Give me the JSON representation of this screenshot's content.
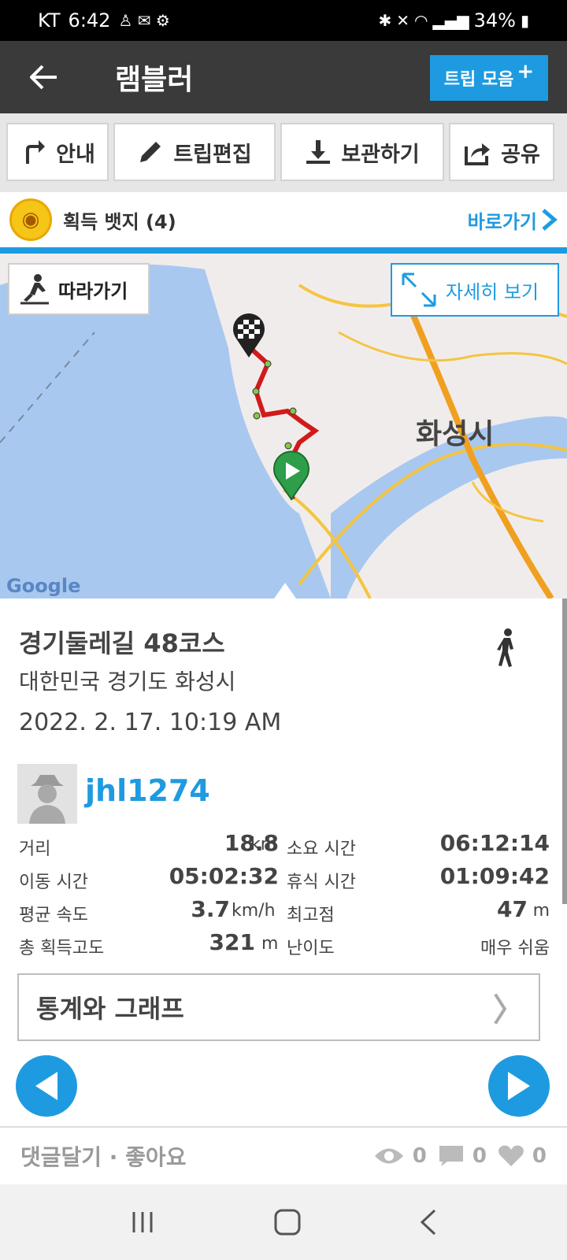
{
  "status_bar": {
    "carrier": "KT",
    "time": "6:42",
    "battery": "34%"
  },
  "app_bar": {
    "title": "램블러",
    "trip_collection_label": "트립 모음"
  },
  "toolbar": {
    "guide": "안내",
    "edit_trip": "트립편집",
    "save": "보관하기",
    "share": "공유"
  },
  "badges": {
    "label": "획득 뱃지 (4)",
    "go_label": "바로가기"
  },
  "map": {
    "follow_label": "따라가기",
    "detail_label": "자세히 보기",
    "city": "화성시",
    "attribution": "Google"
  },
  "trip": {
    "title": "경기둘레길 48코스",
    "location": "대한민국 경기도 화성시",
    "date": "2022. 2. 17. 10:19 AM",
    "username": "jhl1274"
  },
  "stats": {
    "rows": [
      {
        "label1": "거리",
        "value1": "18.8",
        "unit1": "km",
        "label2": "소요 시간",
        "value2": "06:12:14"
      },
      {
        "label1": "이동 시간",
        "value1": "05:02:32",
        "label2": "휴식 시간",
        "value2": "01:09:42"
      },
      {
        "label1": "평균 속도",
        "value1": "3.7",
        "unit1": "km/h",
        "label2": "최고점",
        "value2": "47",
        "unit2": "m"
      },
      {
        "label1": "총 획득고도",
        "value1": "321",
        "unit1": "m",
        "label2": "난이도",
        "value2": "매우 쉬움"
      }
    ]
  },
  "graph_button_label": "통계와 그래프",
  "bottom_bar": {
    "comment_like": "댓글달기 · 좋아요",
    "views": "0",
    "comments": "0",
    "likes": "0"
  },
  "colors": {
    "accent": "#1e9be0",
    "appbar": "#3a3a3a",
    "route": "#d11a1a"
  }
}
